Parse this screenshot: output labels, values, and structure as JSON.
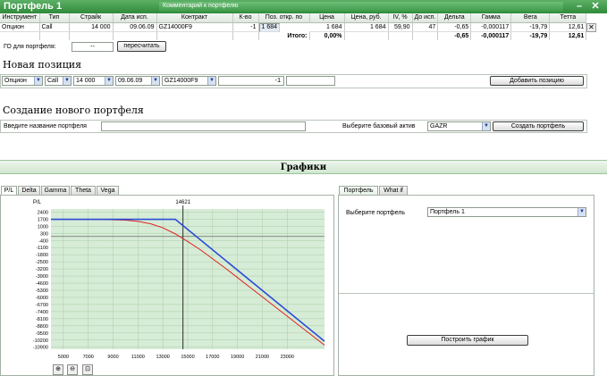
{
  "window": {
    "title": "Портфель 1",
    "comment_placeholder": "Комментарий к портфелю",
    "minimize": "–",
    "close": "✕"
  },
  "table": {
    "headers": [
      "Инструмент",
      "Тип",
      "Страйк",
      "Дата исп.",
      "Контракт",
      "К-во",
      "Поз. откр. по",
      "Цена",
      "Цена, руб.",
      "IV, %",
      "До исп.",
      "Дельта",
      "Гамма",
      "Вега",
      "Тетта"
    ],
    "row": [
      "Опцион",
      "Call",
      "14 000",
      "09.06.09",
      "GZ14000F9",
      "-1",
      "1 684",
      "1 684",
      "1 684",
      "59,90",
      "47",
      "-0,65",
      "-0,000117",
      "-19,79",
      "12,61"
    ],
    "total": {
      "label": "Итого:",
      "value": "0,00%",
      "delta": "-0,65",
      "gamma": "-0,000117",
      "vega": "-19,79",
      "theta": "12,61"
    }
  },
  "go": {
    "label": "ГО для портфеля:",
    "value": "--",
    "recalc_button": "пересчитать"
  },
  "new_position": {
    "heading": "Новая позиция",
    "instrument": "Опцион",
    "type": "Call",
    "strike": "14 000",
    "date": "09.06.09",
    "contract": "GZ14000F9",
    "qty": "-1",
    "price": "",
    "add_button": "Добавить позицию"
  },
  "new_portfolio": {
    "heading": "Создание нового портфеля",
    "name_label": "Введите название портфеля",
    "asset_label": "Выберите базовый актив",
    "asset": "GAZR",
    "create_button": "Создать портфель"
  },
  "graphs": {
    "heading": "Графики",
    "tabs": [
      "P/L",
      "Delta",
      "Gamma",
      "Theta",
      "Vega"
    ],
    "right_tabs": [
      "Портфель",
      "What if"
    ],
    "select_label": "Выберите портфель",
    "select_value": "Портфель 1",
    "build_button": "Построить график",
    "zoom_icons": [
      "zoom-in-icon",
      "zoom-out-icon",
      "zoom-fit-icon"
    ]
  },
  "chart_data": {
    "type": "line",
    "ylabel": "P/L",
    "marker_label": "14621",
    "marker_x": 14621,
    "xlim": [
      4000,
      26000
    ],
    "ylim": [
      -11100,
      2700
    ],
    "xticks": [
      5000,
      7000,
      9000,
      11000,
      13000,
      15000,
      17000,
      19000,
      21000,
      23000
    ],
    "yticks": [
      2400,
      1700,
      1000,
      300,
      -400,
      -1100,
      -1800,
      -2500,
      -3200,
      -3900,
      -4600,
      -5300,
      -6000,
      -6700,
      -7400,
      -8100,
      -8800,
      -9500,
      -10200,
      -10900
    ],
    "colors": {
      "expiration": "#2b4bd6",
      "current": "#e02020",
      "area": "#d6ecd6",
      "grid": "#a9cca9"
    },
    "series": [
      {
        "key": "expiration",
        "x": [
          4000,
          14000,
          26000
        ],
        "y": [
          1684,
          1684,
          -10316
        ]
      },
      {
        "key": "current",
        "x": [
          4000,
          8000,
          10000,
          11000,
          12000,
          13000,
          14000,
          15000,
          16000,
          17000,
          18000,
          19000,
          20000,
          21000,
          22000,
          23000,
          24000,
          25000,
          26000
        ],
        "y": [
          1684,
          1670,
          1600,
          1480,
          1250,
          850,
          250,
          -500,
          -1300,
          -2200,
          -3100,
          -4050,
          -5000,
          -5950,
          -6900,
          -7850,
          -8800,
          -9750,
          -10700
        ]
      }
    ]
  }
}
